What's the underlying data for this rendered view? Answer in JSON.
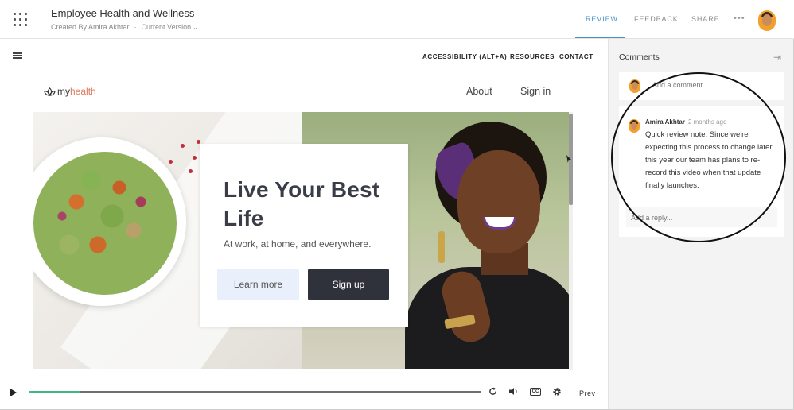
{
  "header": {
    "title": "Employee Health and Wellness",
    "created_by": "Created By Amira Akhtar",
    "separator": "·",
    "version": "Current Version",
    "version_chevron": "⌄",
    "tabs": [
      {
        "label": "REVIEW",
        "active": true
      },
      {
        "label": "FEEDBACK",
        "active": false
      },
      {
        "label": "SHARE",
        "active": false
      }
    ],
    "more": "•••",
    "accent_color": "#4a90c4"
  },
  "site": {
    "top_links": [
      "ACCESSIBILITY (ALT+A)",
      "RESOURCES",
      "CONTACT"
    ],
    "brand_prefix": "my",
    "brand_suffix": "health",
    "nav": [
      "About",
      "Sign in"
    ],
    "hero_title": "Live Your Best Life",
    "hero_subtitle": "At work, at home, and everywhere.",
    "learn_more": "Learn more",
    "sign_up": "Sign up"
  },
  "player": {
    "progress": 0.115,
    "progress_color": "#3fb882",
    "cc_label": "CC",
    "prev_label": "Prev"
  },
  "comments": {
    "title": "Comments",
    "input_placeholder": "Add a comment...",
    "items": [
      {
        "author": "Amira Akhtar",
        "time": "2 months ago",
        "text": "Quick review note: Since we're expecting this process to change later this year our team has plans to re-record this video when that update finally launches.",
        "reply_placeholder": "Add a reply..."
      }
    ]
  }
}
